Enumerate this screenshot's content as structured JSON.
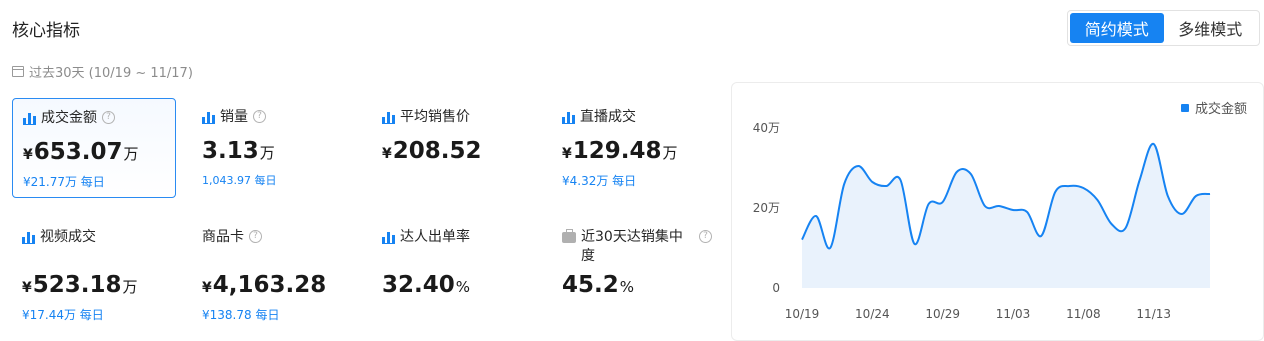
{
  "header": {
    "title": "核心指标",
    "modes": [
      {
        "label": "简约模式",
        "active": true
      },
      {
        "label": "多维模式",
        "active": false
      }
    ],
    "period": "过去30天 (10/19 ~ 11/17)"
  },
  "metrics": [
    {
      "label": "成交金额",
      "icon": "bar-chart-icon",
      "help": true,
      "currency": "¥",
      "value": "653.07",
      "unit": "万",
      "daily": "¥21.77万 每日",
      "selected": true
    },
    {
      "label": "销量",
      "icon": "bar-chart-icon",
      "help": true,
      "currency": "",
      "value": "3.13",
      "unit": "万",
      "daily": "1,043.97 每日"
    },
    {
      "label": "平均销售价",
      "icon": "bar-chart-icon",
      "help": false,
      "currency": "¥",
      "value": "208.52",
      "unit": "",
      "daily": ""
    },
    {
      "label": "直播成交",
      "icon": "bar-chart-icon",
      "help": false,
      "currency": "¥",
      "value": "129.48",
      "unit": "万",
      "daily": "¥4.32万 每日"
    },
    {
      "label": "视频成交",
      "icon": "bar-chart-icon",
      "help": false,
      "currency": "¥",
      "value": "523.18",
      "unit": "万",
      "daily": "¥17.44万 每日"
    },
    {
      "label": "商品卡",
      "icon": "none",
      "help": true,
      "currency": "¥",
      "value": "4,163.28",
      "unit": "",
      "daily": "¥138.78 每日"
    },
    {
      "label": "达人出单率",
      "icon": "bar-chart-icon",
      "help": false,
      "currency": "",
      "value": "32.40",
      "unit": "%",
      "daily": ""
    },
    {
      "label": "近30天达销集中度",
      "icon": "bag-icon",
      "help": true,
      "currency": "",
      "value": "45.2",
      "unit": "%",
      "daily": ""
    }
  ],
  "chart_data": {
    "type": "area",
    "legend": [
      "成交金额"
    ],
    "legend_position": "top-right",
    "color": "#1683f2",
    "ylim": [
      0,
      40
    ],
    "yticks": [
      "0",
      "20万",
      "40万"
    ],
    "ytick_values": [
      0,
      20,
      40
    ],
    "xticks": [
      "10/19",
      "10/24",
      "10/29",
      "11/03",
      "11/08",
      "11/13"
    ],
    "x": [
      "10/19",
      "10/20",
      "10/21",
      "10/22",
      "10/23",
      "10/24",
      "10/25",
      "10/26",
      "10/27",
      "10/28",
      "10/29",
      "10/30",
      "10/31",
      "11/01",
      "11/02",
      "11/03",
      "11/04",
      "11/05",
      "11/06",
      "11/07",
      "11/08",
      "11/09",
      "11/10",
      "11/11",
      "11/12",
      "11/13",
      "11/14",
      "11/15",
      "11/16",
      "11/17"
    ],
    "series": [
      {
        "name": "成交金额",
        "values": [
          12.1,
          18.0,
          10.0,
          26.0,
          30.5,
          26.5,
          25.5,
          27.0,
          11.0,
          21.0,
          21.5,
          29.0,
          28.5,
          20.5,
          20.5,
          19.5,
          19.0,
          13.0,
          24.0,
          25.5,
          25.0,
          22.0,
          16.0,
          15.0,
          27.0,
          36.0,
          23.0,
          18.5,
          23.0,
          23.5
        ]
      }
    ]
  }
}
